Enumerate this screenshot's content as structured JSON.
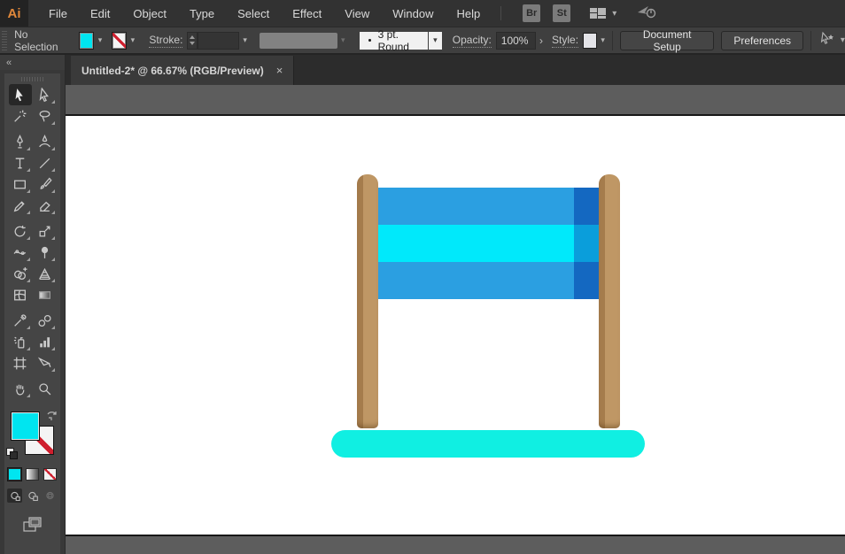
{
  "menubar": {
    "logo": "Ai",
    "items": [
      "File",
      "Edit",
      "Object",
      "Type",
      "Select",
      "Effect",
      "View",
      "Window",
      "Help"
    ],
    "bridge_button": "Br",
    "stock_button": "St"
  },
  "control_bar": {
    "selection_status": "No Selection",
    "stroke_label": "Stroke:",
    "brush_preset": "3 pt. Round",
    "opacity_label": "Opacity:",
    "opacity_value": "100%",
    "style_label": "Style:",
    "document_setup_button": "Document Setup",
    "preferences_button": "Preferences",
    "fill_color": "#00e5f0",
    "stroke_style": "none"
  },
  "document_tab": {
    "title": "Untitled-2* @ 66.67% (RGB/Preview)",
    "close_glyph": "×"
  },
  "toolbar": {
    "collapse_glyph": "«",
    "active_tool": "selection",
    "fill_color": "#00e5f0",
    "stroke_style": "none",
    "tools": [
      "selection",
      "direct-selection",
      "magic-wand",
      "lasso",
      "pen",
      "curvature",
      "type",
      "line-segment",
      "rectangle",
      "paintbrush",
      "shaper",
      "eraser",
      "rotate",
      "scale",
      "width",
      "puppet-warp",
      "shape-builder",
      "perspective-grid",
      "mesh",
      "gradient",
      "eyedropper",
      "blend",
      "symbol-sprayer",
      "column-graph",
      "artboard",
      "slice",
      "hand",
      "zoom"
    ]
  },
  "canvas": {
    "pasteboard_color": "#5d5d5d",
    "artboard_color": "#ffffff",
    "artwork": {
      "post_color": "#bf9765",
      "post_shade_color": "#a57c4c",
      "stripe_blue": "#2b9fe1",
      "stripe_cyan": "#00e9fb",
      "stripe_dark_blue": "#1468c1",
      "stripe_mid_blue": "#0a9edb",
      "base_color": "#10efe2"
    }
  }
}
